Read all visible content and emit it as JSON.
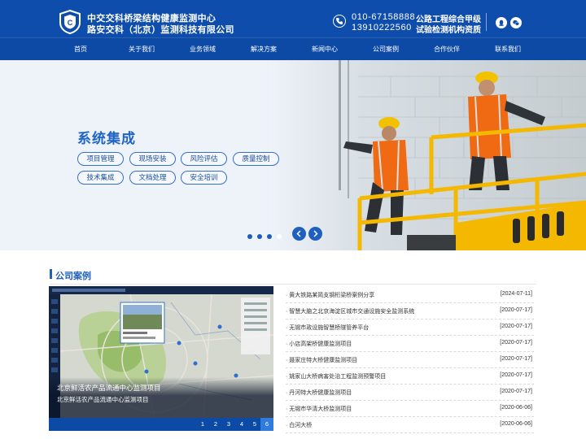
{
  "header": {
    "org_line1": "中交交科桥梁结构健康监测中心",
    "org_line2": "路安交科（北京）监测科技有限公司",
    "phone1": "010-67158888",
    "phone2": "13910222560",
    "qualification_line1": "公路工程综合甲级",
    "qualification_line2": "试验检测机构资质",
    "icons": [
      "shield-logo-icon",
      "phone-icon",
      "qq-icon",
      "wechat-icon"
    ],
    "brand_color": "#0e4dab"
  },
  "nav": {
    "items": [
      "首页",
      "关于我们",
      "业务领域",
      "解决方案",
      "新闻中心",
      "公司案例",
      "合作伙伴",
      "联系我们"
    ]
  },
  "banner": {
    "title": "系统集成",
    "tags": [
      "项目管理",
      "现场安装",
      "风险评估",
      "质量控制",
      "技术集成",
      "文档处理",
      "安全培训"
    ],
    "slide_count": 4,
    "active_slide": 4,
    "accent_color": "#2165c4"
  },
  "cases": {
    "section_title": "公司案例",
    "feature": {
      "caption_title": "北京鲜活农产品流通中心监测项目",
      "caption_subtitle": "北京鲜活农产品流通中心监测项目",
      "pages": [
        "1",
        "2",
        "3",
        "4",
        "5",
        "6"
      ],
      "active_page": "6"
    },
    "list": [
      {
        "title": "黄大铁路某简支钢桁梁桥案例分享",
        "date": "[2024-07-11]"
      },
      {
        "title": "智慧大脑之北京海淀区城市交通设施安全监测系统",
        "date": "[2020-07-17]"
      },
      {
        "title": "无锡市政设施智慧桥隧管养平台",
        "date": "[2020-07-17]"
      },
      {
        "title": "小店高架桥健康监测项目",
        "date": "[2020-07-17]"
      },
      {
        "title": "聂家庄特大桥健康监测项目",
        "date": "[2020-07-17]"
      },
      {
        "title": "姚家山大桥病害处治工程监测预警项目",
        "date": "[2020-07-17]"
      },
      {
        "title": "丹河特大桥健康监测项目",
        "date": "[2020-07-17]"
      },
      {
        "title": "无锡市华清大桥监测项目",
        "date": "[2020-06-06]"
      },
      {
        "title": "白河大桥",
        "date": "[2020-06-06]"
      }
    ]
  }
}
